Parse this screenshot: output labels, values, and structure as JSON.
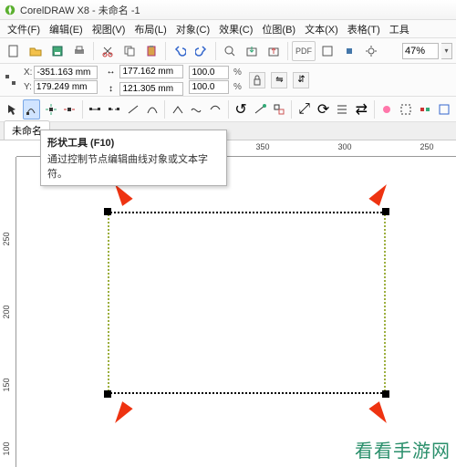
{
  "app": {
    "title": "CorelDRAW X8 - 未命名 -1"
  },
  "menu": {
    "items": [
      "文件(F)",
      "编辑(E)",
      "视图(V)",
      "布局(L)",
      "对象(C)",
      "效果(C)",
      "位图(B)",
      "文本(X)",
      "表格(T)",
      "工具"
    ]
  },
  "toolbar1": {
    "pdf_label": "PDF",
    "zoom_value": "47%"
  },
  "propbar": {
    "x_label": "X:",
    "x_value": "-351.163 mm",
    "y_label": "Y:",
    "y_value": "179.249 mm",
    "w_value": "177.162 mm",
    "h_value": "121.305 mm",
    "sx_value": "100.0",
    "sy_value": "100.0",
    "pct_label": "%"
  },
  "tabs": {
    "active": "未命名"
  },
  "rulerH": {
    "ticks": [
      "350",
      "300",
      "250"
    ]
  },
  "rulerV": {
    "ticks": [
      "250",
      "200",
      "150",
      "100"
    ]
  },
  "tooltip": {
    "title": "形状工具 (F10)",
    "body": "通过控制节点编辑曲线对象或文本字符。"
  },
  "watermark": "看看手游网"
}
